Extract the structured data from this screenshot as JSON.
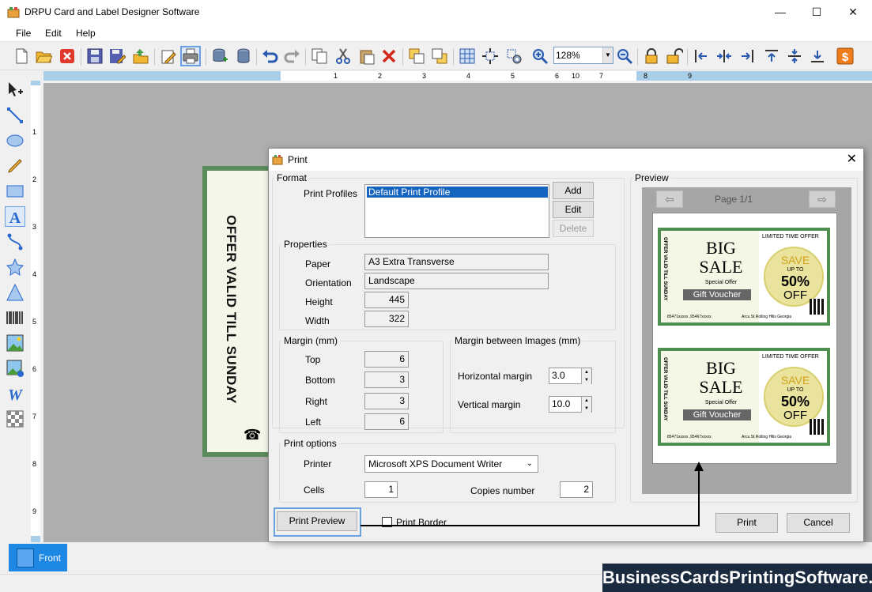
{
  "window": {
    "title": "DRPU Card and Label Designer Software",
    "minimize": "—",
    "maximize": "☐",
    "close": "✕"
  },
  "menu": [
    "File",
    "Edit",
    "Help"
  ],
  "toolbar": {
    "zoom_value": "128%"
  },
  "ruler": {
    "top": [
      "1",
      "2",
      "3",
      "4",
      "5",
      "6",
      "7",
      "8",
      "9",
      "10"
    ],
    "left": [
      "1",
      "2",
      "3",
      "4",
      "5",
      "6",
      "7",
      "8",
      "9"
    ]
  },
  "canvas": {
    "card_text": "OFFER VALID TILL SUNDAY",
    "phone_symbol": "☎"
  },
  "tabs": {
    "front": "Front"
  },
  "watermark": "BusinessCardsPrintingSoftware.com",
  "dialog": {
    "title": "Print",
    "format_legend": "Format",
    "print_profiles_label": "Print Profiles",
    "profiles": [
      "Default Print Profile"
    ],
    "add_button": "Add",
    "edit_button": "Edit",
    "delete_button": "Delete",
    "properties_legend": "Properties",
    "paper_label": "Paper",
    "paper_value": "A3 Extra Transverse",
    "orientation_label": "Orientation",
    "orientation_value": "Landscape",
    "height_label": "Height",
    "height_value": "445",
    "width_label": "Width",
    "width_value": "322",
    "margin_legend": "Margin (mm)",
    "top_label": "Top",
    "top_value": "6",
    "bottom_label": "Bottom",
    "bottom_value": "3",
    "right_label": "Right",
    "right_value": "3",
    "left_label": "Left",
    "left_value": "6",
    "margin_images_legend": "Margin between Images (mm)",
    "horizontal_margin_label": "Horizontal margin",
    "horizontal_margin_value": "3.0",
    "vertical_margin_label": "Vertical margin",
    "vertical_margin_value": "10.0",
    "print_options_legend": "Print options",
    "printer_label": "Printer",
    "printer_value": "Microsoft XPS Document Writer",
    "cells_label": "Cells",
    "cells_value": "1",
    "copies_label": "Copies number",
    "copies_value": "2",
    "print_preview_button": "Print Preview",
    "print_border_label": "Print Border",
    "print_button": "Print",
    "cancel_button": "Cancel",
    "preview_legend": "Preview",
    "page_label": "Page 1/1"
  },
  "voucher": {
    "limited": "LIMITED TIME OFFER",
    "big": "BIG",
    "sale": "SALE",
    "special": "Special Offer",
    "gift": "Gift Voucher",
    "save": "SAVE",
    "upto": "UP TO",
    "percent": "50%",
    "off": "OFF",
    "vertical": "OFFER VALID TILL SUNDAY",
    "phone": "85471xxxxx ,95467xxxxx",
    "address": "Arcu St.Rolling Hills Georgia"
  },
  "colors": {
    "accent": "#1e88e5",
    "card_green": "#5b8b5b",
    "selection_blue": "#1565c0"
  }
}
